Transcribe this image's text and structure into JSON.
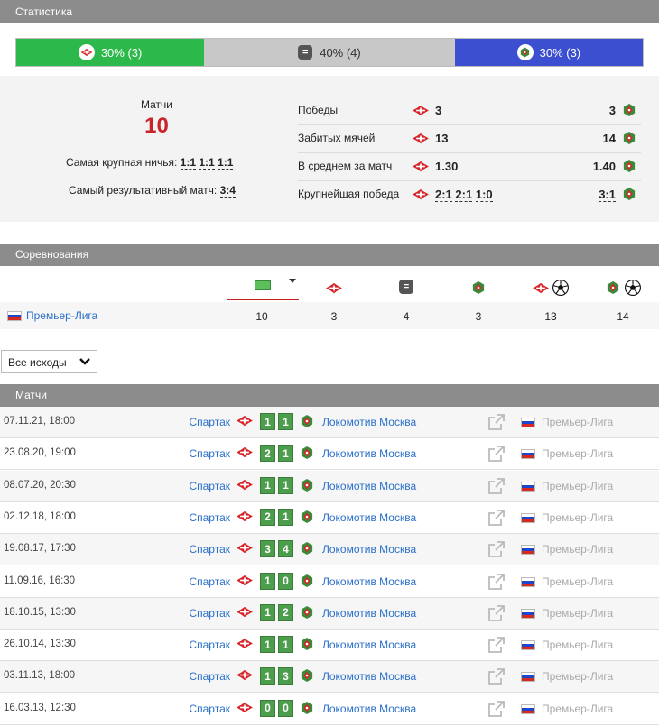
{
  "stats": {
    "title": "Статистика",
    "bar": [
      {
        "text": "30% (3)",
        "pct": 30,
        "icon": "spartak-icon",
        "color": "#2db84b"
      },
      {
        "text": "40% (4)",
        "pct": 40,
        "icon": "draw-icon",
        "color": "#c8c8c8"
      },
      {
        "text": "30% (3)",
        "pct": 30,
        "icon": "lokomotiv-icon",
        "color": "#3b4fd0"
      }
    ],
    "matches_label": "Матчи",
    "matches_count": "10",
    "biggest_draw_label": "Самая крупная ничья:",
    "biggest_draw": [
      "1:1",
      "1:1",
      "1:1"
    ],
    "most_goals_label": "Самый результативный матч:",
    "most_goals": "3:4",
    "rows": [
      {
        "label": "Победы",
        "left": "3",
        "right": "3"
      },
      {
        "label": "Забитых мячей",
        "left": "13",
        "right": "14"
      },
      {
        "label": "В среднем за матч",
        "left": "1.30",
        "right": "1.40"
      },
      {
        "label": "Крупнейшая победа",
        "left": [
          "2:1",
          "2:1",
          "1:0"
        ],
        "right": "3:1"
      }
    ]
  },
  "competitions": {
    "title": "Соревнования",
    "league": "Премьер-Лига",
    "values": [
      "10",
      "3",
      "4",
      "3",
      "13",
      "14"
    ]
  },
  "filter": {
    "label": "Все исходы"
  },
  "matches": {
    "title": "Матчи",
    "home": "Спартак",
    "away": "Локомотив Москва",
    "league": "Премьер-Лига",
    "rows": [
      {
        "date": "07.11.21, 18:00",
        "s1": "1",
        "s2": "1"
      },
      {
        "date": "23.08.20, 19:00",
        "s1": "2",
        "s2": "1"
      },
      {
        "date": "08.07.20, 20:30",
        "s1": "1",
        "s2": "1"
      },
      {
        "date": "02.12.18, 18:00",
        "s1": "2",
        "s2": "1"
      },
      {
        "date": "19.08.17, 17:30",
        "s1": "3",
        "s2": "4"
      },
      {
        "date": "11.09.16, 16:30",
        "s1": "1",
        "s2": "0"
      },
      {
        "date": "18.10.15, 13:30",
        "s1": "1",
        "s2": "2"
      },
      {
        "date": "26.10.14, 13:30",
        "s1": "1",
        "s2": "1"
      },
      {
        "date": "03.11.13, 18:00",
        "s1": "1",
        "s2": "3"
      },
      {
        "date": "16.03.13, 12:30",
        "s1": "0",
        "s2": "0"
      }
    ]
  }
}
